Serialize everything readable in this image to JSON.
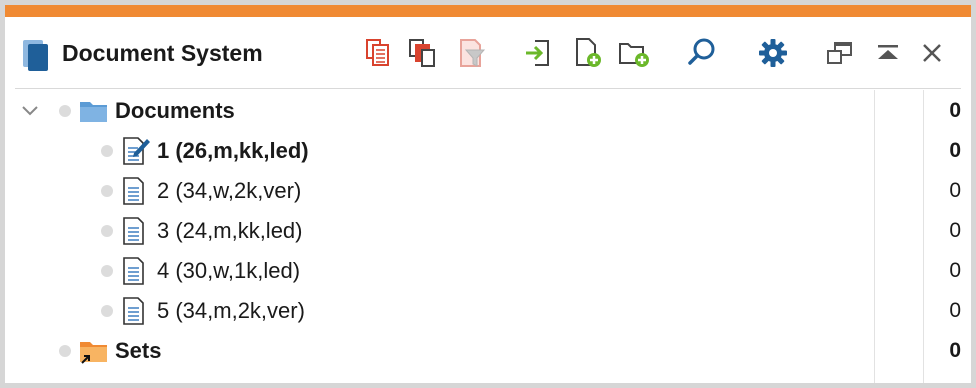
{
  "header": {
    "title": "Document System",
    "toolbar_icons": [
      "paste-structure-icon",
      "copy-documents-icon",
      "filter-icon",
      "import-icon",
      "new-document-icon",
      "new-set-icon",
      "search-icon",
      "settings-gear-icon",
      "undock-window-icon",
      "collapse-panel-icon",
      "close-icon"
    ]
  },
  "tree": {
    "documents": {
      "label": "Documents",
      "count": "0"
    },
    "items": [
      {
        "label": "1 (26,m,kk,led)",
        "count": "0",
        "active": true
      },
      {
        "label": "2 (34,w,2k,ver)",
        "count": "0"
      },
      {
        "label": "3 (24,m,kk,led)",
        "count": "0"
      },
      {
        "label": "4 (30,w,1k,led)",
        "count": "0"
      },
      {
        "label": "5 (34,m,2k,ver)",
        "count": "0"
      }
    ],
    "sets": {
      "label": "Sets",
      "count": "0"
    }
  },
  "colors": {
    "accent": "#f08a33",
    "folder_blue": "#5b9bd5",
    "folder_orange": "#f5a044",
    "icon_blue": "#1f5f99",
    "icon_red": "#d9432e",
    "icon_green": "#6bb82a"
  }
}
